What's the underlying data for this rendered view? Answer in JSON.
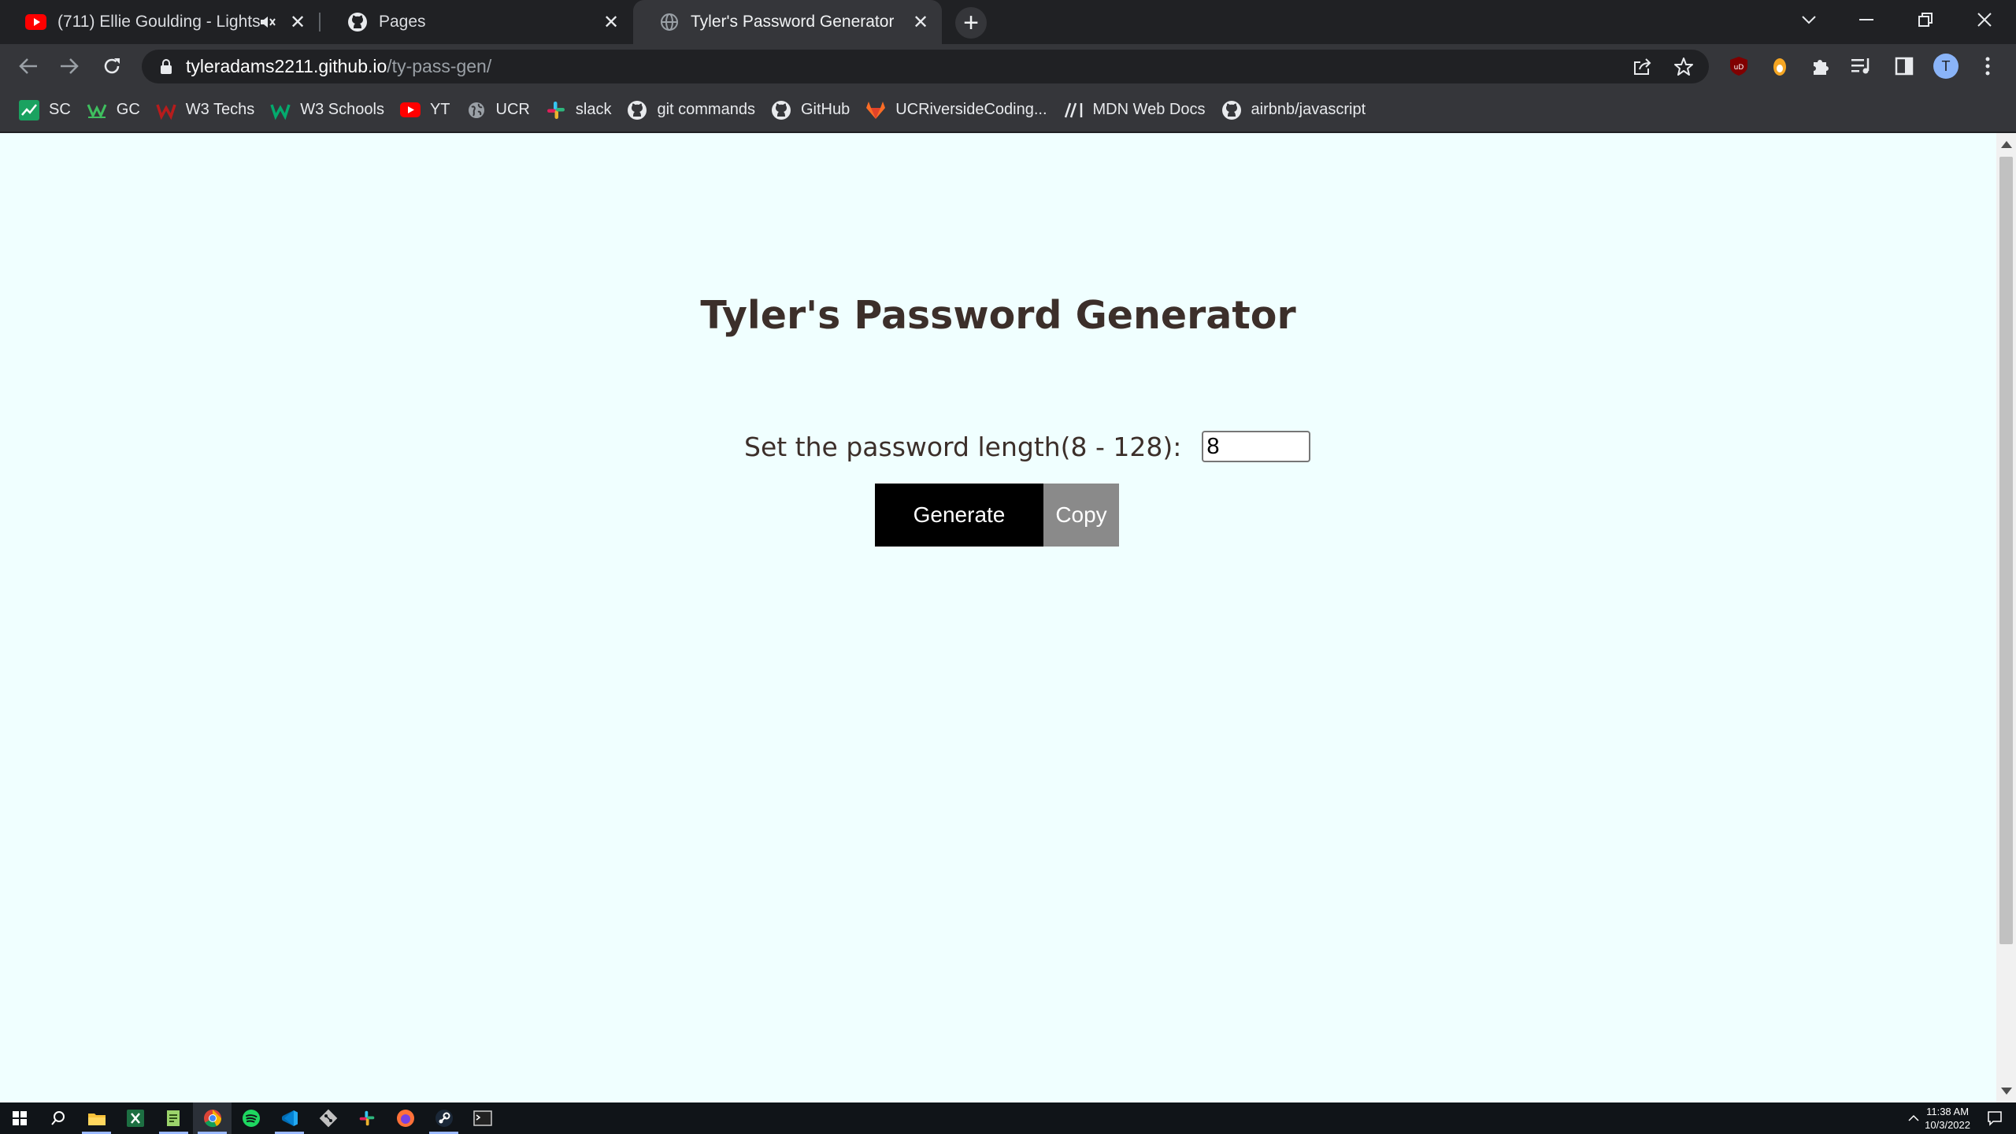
{
  "browser": {
    "tabs": [
      {
        "title": "(711) Ellie Goulding - Lights (",
        "favicon": "youtube-icon",
        "audio": "muted-speaker-icon"
      },
      {
        "title": "Pages",
        "favicon": "github-icon"
      },
      {
        "title": "Tyler's Password Generator",
        "favicon": "globe-icon",
        "active": true
      }
    ],
    "new_tab": "+",
    "url_host": "tyleradams2211.github.io",
    "url_path": "/ty-pass-gen/",
    "profile_initial": "T",
    "bookmarks": [
      {
        "label": "SC",
        "icon": "chart-icon"
      },
      {
        "label": "GC",
        "icon": "gc-icon"
      },
      {
        "label": "W3 Techs",
        "icon": "w3techs-icon"
      },
      {
        "label": "W3 Schools",
        "icon": "w3schools-icon"
      },
      {
        "label": "YT",
        "icon": "youtube-icon"
      },
      {
        "label": "UCR",
        "icon": "globe-icon"
      },
      {
        "label": "slack",
        "icon": "slack-icon"
      },
      {
        "label": "git commands",
        "icon": "github-icon"
      },
      {
        "label": "GitHub",
        "icon": "github-icon"
      },
      {
        "label": "UCRiversideCoding...",
        "icon": "gitlab-icon"
      },
      {
        "label": "MDN Web Docs",
        "icon": "mdn-icon"
      },
      {
        "label": "airbnb/javascript",
        "icon": "github-icon"
      }
    ]
  },
  "page": {
    "title": "Tyler's Password Generator",
    "length_label": "Set the password length(8 - 128):",
    "length_value": "8",
    "generate_label": "Generate",
    "copy_label": "Copy"
  },
  "taskbar": {
    "time": "11:38 AM",
    "date": "10/3/2022"
  },
  "colors": {
    "page_background": "#f0ffff",
    "heading_text": "#3c2f2a",
    "generate_button": "#000000",
    "copy_button": "#8a8a8a"
  }
}
